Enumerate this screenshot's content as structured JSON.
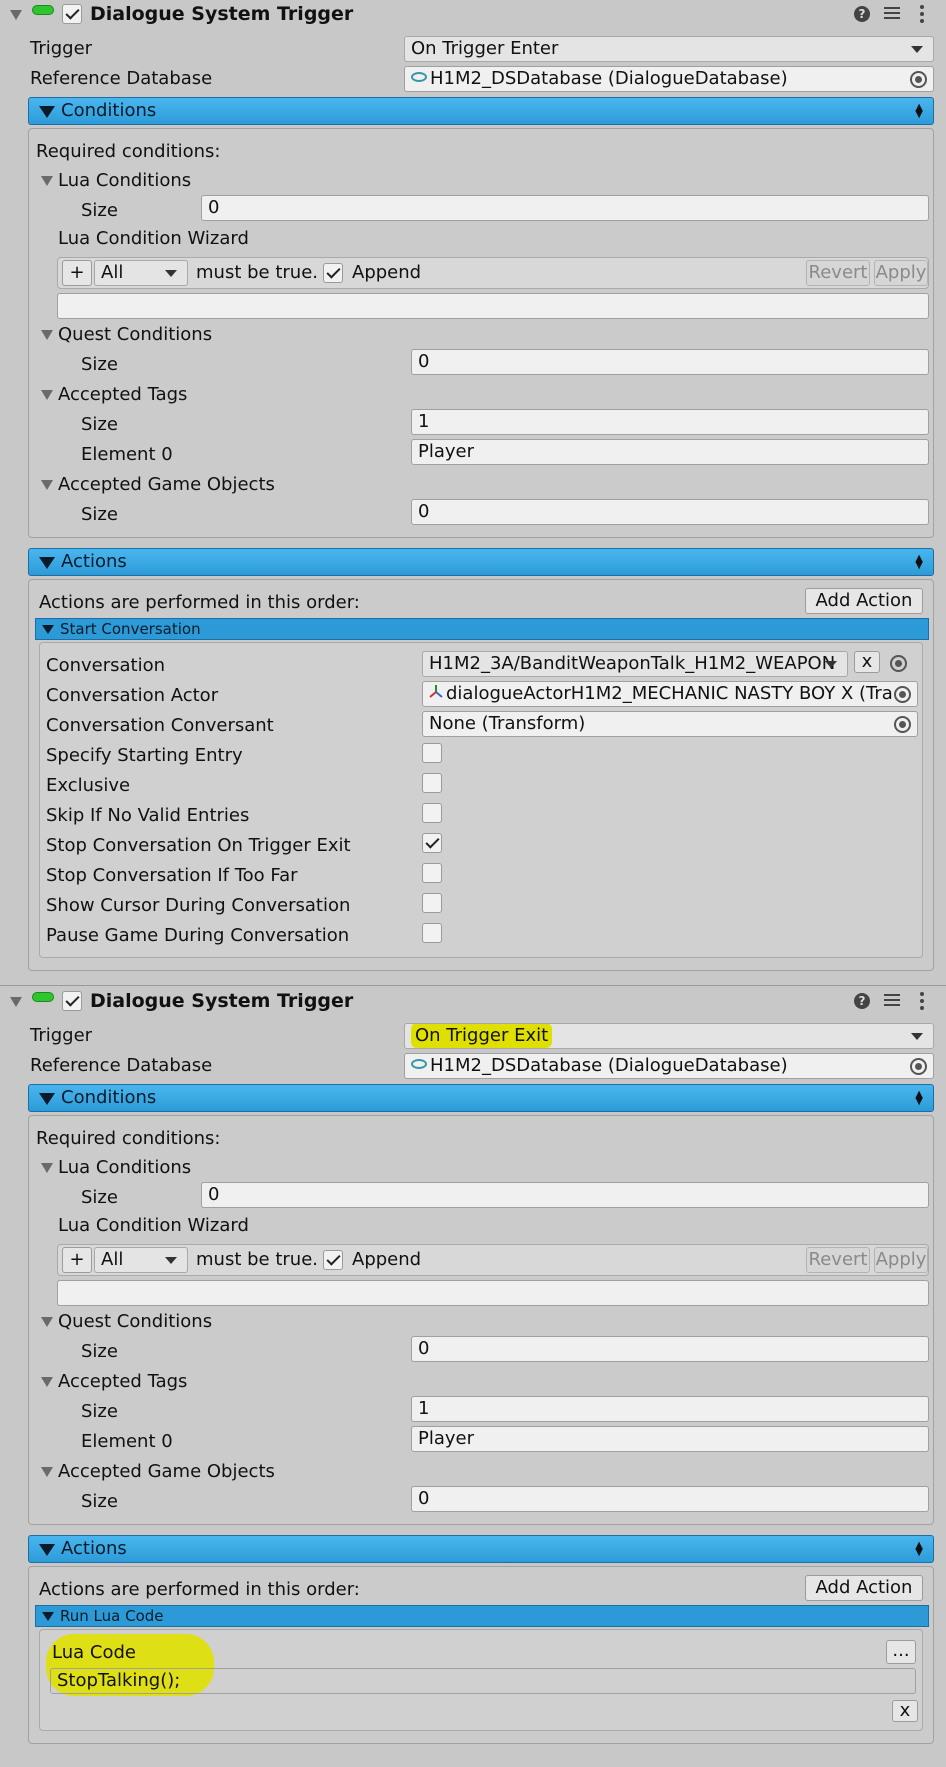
{
  "components": [
    {
      "title": "Dialogue System Trigger",
      "trigger_label": "Trigger",
      "trigger_value": "On Trigger Enter",
      "refdb_label": "Reference Database",
      "refdb_value": "H1M2_DSDatabase (DialogueDatabase)",
      "conditions_header": "Conditions",
      "required_conditions": "Required conditions:",
      "lua_conditions": "Lua Conditions",
      "size_label": "Size",
      "lua_size": "0",
      "lua_wizard": "Lua Condition Wizard",
      "plus": "+",
      "all_value": "All",
      "must_be_true": "must be true.",
      "append": "Append",
      "revert": "Revert",
      "apply": "Apply",
      "quest_conditions": "Quest Conditions",
      "quest_size": "0",
      "accepted_tags": "Accepted Tags",
      "tags_size": "1",
      "element0_label": "Element 0",
      "element0_value": "Player",
      "accepted_gameobjects": "Accepted Game Objects",
      "go_size": "0",
      "actions_header": "Actions",
      "actions_order": "Actions are performed in this order:",
      "add_action": "Add Action"
    },
    {
      "title": "Dialogue System Trigger",
      "trigger_label": "Trigger",
      "trigger_value": "On Trigger Exit",
      "refdb_label": "Reference Database",
      "refdb_value": "H1M2_DSDatabase (DialogueDatabase)",
      "conditions_header": "Conditions",
      "required_conditions": "Required conditions:",
      "lua_conditions": "Lua Conditions",
      "size_label": "Size",
      "lua_size": "0",
      "lua_wizard": "Lua Condition Wizard",
      "plus": "+",
      "all_value": "All",
      "must_be_true": "must be true.",
      "append": "Append",
      "revert": "Revert",
      "apply": "Apply",
      "quest_conditions": "Quest Conditions",
      "quest_size": "0",
      "accepted_tags": "Accepted Tags",
      "tags_size": "1",
      "element0_label": "Element 0",
      "element0_value": "Player",
      "accepted_gameobjects": "Accepted Game Objects",
      "go_size": "0",
      "actions_header": "Actions",
      "actions_order": "Actions are performed in this order:",
      "add_action": "Add Action"
    }
  ],
  "start_conversation": {
    "header": "Start Conversation",
    "conversation_label": "Conversation",
    "conversation_value": "H1M2_3A/BanditWeaponTalk_H1M2_WEAPON",
    "x_button": "x",
    "actor_label": "Conversation Actor",
    "actor_value": "dialogueActorH1M2_MECHANIC NASTY BOY X (Tra",
    "conversant_label": "Conversation Conversant",
    "conversant_value": "None (Transform)",
    "options": [
      {
        "label": "Specify Starting Entry",
        "checked": false
      },
      {
        "label": "Exclusive",
        "checked": false
      },
      {
        "label": "Skip If No Valid Entries",
        "checked": false
      },
      {
        "label": "Stop Conversation On Trigger Exit",
        "checked": true
      },
      {
        "label": "Stop Conversation If Too Far",
        "checked": false
      },
      {
        "label": "Show Cursor During Conversation",
        "checked": false
      },
      {
        "label": "Pause Game During Conversation",
        "checked": false
      }
    ]
  },
  "run_lua_code": {
    "header": "Run Lua Code",
    "lua_code_label": "Lua Code",
    "ellipsis_button": "...",
    "code_value": "StopTalking();",
    "x_button": "x"
  },
  "colors": {
    "bluebar": "#2d9bd8",
    "highlight": "#e0e000",
    "toggle_green": "#2ec52e"
  }
}
